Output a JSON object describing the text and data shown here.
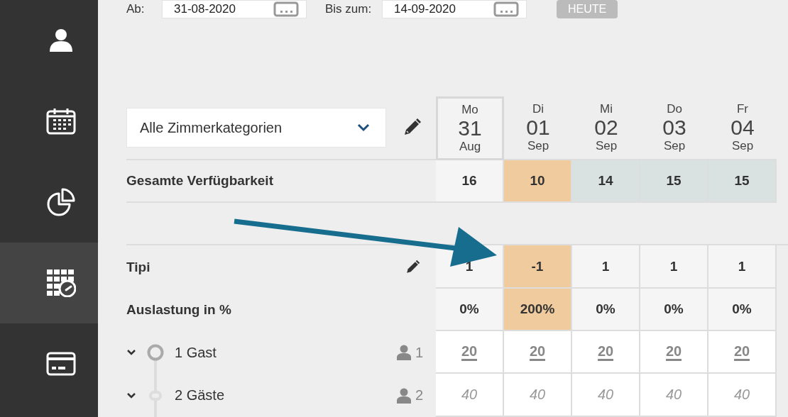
{
  "sidebar": {
    "items": [
      {
        "kind": "user",
        "selected": false
      },
      {
        "kind": "calendar",
        "selected": false
      },
      {
        "kind": "chart",
        "selected": false
      },
      {
        "kind": "availability",
        "selected": true
      },
      {
        "kind": "card",
        "selected": false
      }
    ]
  },
  "filters": {
    "from_label": "Ab:",
    "from_value": "31-08-2020",
    "to_label": "Bis zum:",
    "to_value": "14-09-2020",
    "today_button": "HEUTE"
  },
  "category_select": {
    "value": "Alle Zimmerkategorien"
  },
  "days": [
    {
      "weekday": "Mo",
      "day": "31",
      "month": "Aug",
      "selected": true
    },
    {
      "weekday": "Di",
      "day": "01",
      "month": "Sep",
      "selected": false
    },
    {
      "weekday": "Mi",
      "day": "02",
      "month": "Sep",
      "selected": false
    },
    {
      "weekday": "Do",
      "day": "03",
      "month": "Sep",
      "selected": false
    },
    {
      "weekday": "Fr",
      "day": "04",
      "month": "Sep",
      "selected": false
    }
  ],
  "total": {
    "label": "Gesamte Verfügbarkeit",
    "cells": [
      {
        "value": "16",
        "color": "#f5f5f5"
      },
      {
        "value": "10",
        "color": "#f0cb9d"
      },
      {
        "value": "14",
        "color": "#d9e2e1"
      },
      {
        "value": "15",
        "color": "#d9e2e1"
      },
      {
        "value": "15",
        "color": "#d9e2e1"
      }
    ]
  },
  "category": {
    "name": "Tipi",
    "cells": [
      {
        "value": "1",
        "color": "#f5f5f5"
      },
      {
        "value": "-1",
        "color": "#f0cb9d"
      },
      {
        "value": "1",
        "color": "#f5f5f5"
      },
      {
        "value": "1",
        "color": "#f5f5f5"
      },
      {
        "value": "1",
        "color": "#f5f5f5"
      }
    ]
  },
  "occupancy": {
    "label": "Auslastung in %",
    "cells": [
      {
        "value": "0%",
        "color": "#f5f5f5"
      },
      {
        "value": "200%",
        "color": "#f0cb9d"
      },
      {
        "value": "0%",
        "color": "#f5f5f5"
      },
      {
        "value": "0%",
        "color": "#f5f5f5"
      },
      {
        "value": "0%",
        "color": "#f5f5f5"
      }
    ]
  },
  "rates": [
    {
      "label": "1 Gast",
      "persons": "1",
      "kind": "set",
      "values": [
        "20",
        "20",
        "20",
        "20",
        "20"
      ]
    },
    {
      "label": "2 Gäste",
      "persons": "2",
      "kind": "derived",
      "values": [
        "40",
        "40",
        "40",
        "40",
        "40"
      ]
    }
  ]
}
